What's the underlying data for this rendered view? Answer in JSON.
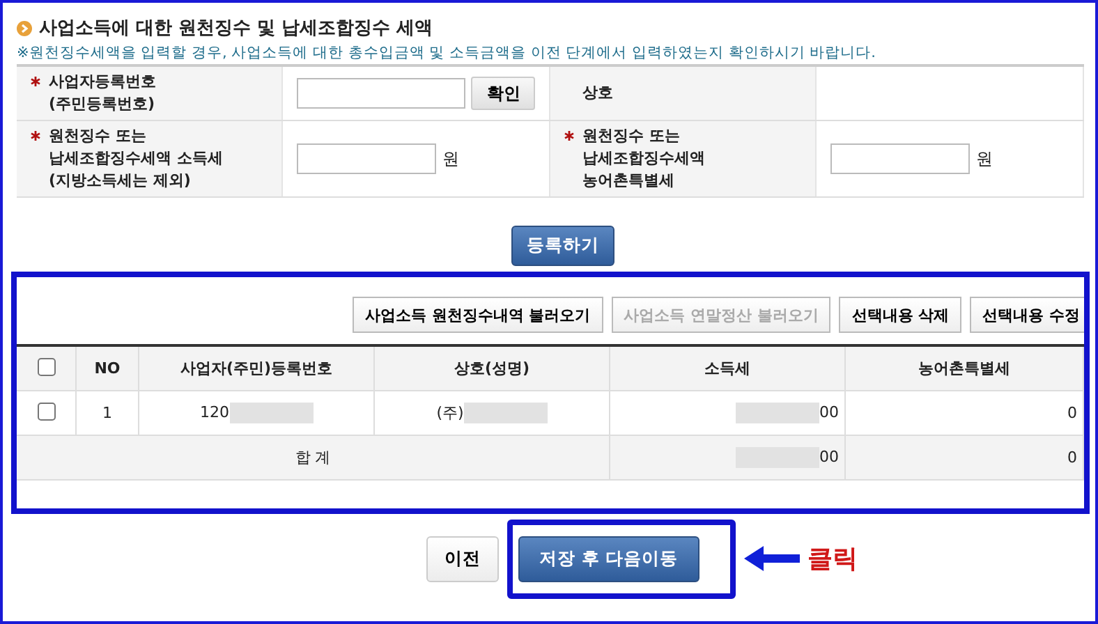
{
  "section": {
    "title": "사업소득에 대한 원천징수 및 납세조합징수 세액",
    "note": "※원천징수세액을 입력할 경우, 사업소득에 대한 총수입금액 및 소득금액을 이전 단계에서 입력하였는지 확인하시기 바랍니다."
  },
  "form": {
    "rows": [
      {
        "cells": [
          {
            "kind": "label",
            "required": true,
            "lines": [
              "사업자등록번호",
              "(주민등록번호)"
            ]
          },
          {
            "kind": "input",
            "button": "확인"
          },
          {
            "kind": "label",
            "required": false,
            "lines": [
              "상호"
            ]
          },
          {
            "kind": "blank"
          }
        ]
      },
      {
        "cells": [
          {
            "kind": "label",
            "required": true,
            "lines": [
              "원천징수 또는",
              "납세조합징수세액 소득세",
              "(지방소득세는 제외)"
            ]
          },
          {
            "kind": "input",
            "unit": "원"
          },
          {
            "kind": "label",
            "required": true,
            "lines": [
              "원천징수 또는",
              "납세조합징수세액",
              "농어촌특별세"
            ]
          },
          {
            "kind": "input",
            "unit": "원"
          }
        ]
      }
    ],
    "register_button": "등록하기"
  },
  "toolbar": [
    {
      "label": "사업소득 원천징수내역 불러오기",
      "disabled": false
    },
    {
      "label": "사업소득 연말정산 불러오기",
      "disabled": true
    },
    {
      "label": "선택내용 삭제",
      "disabled": false
    },
    {
      "label": "선택내용 수정",
      "disabled": false
    }
  ],
  "table": {
    "columns": [
      "NO",
      "사업자(주민)등록번호",
      "상호(성명)",
      "소득세",
      "농어촌특별세"
    ],
    "header_checked": false,
    "rows": [
      {
        "checked": false,
        "cells": [
          "1",
          "120",
          "(주)",
          "00",
          "0"
        ],
        "redacted": [
          false,
          true,
          true,
          true,
          false
        ]
      }
    ],
    "total": {
      "label": "합 계",
      "cells": [
        "00",
        "0"
      ],
      "redacted": [
        true,
        false
      ]
    }
  },
  "footer": {
    "prev_button": "이전",
    "save_button": "저장 후 다음이동",
    "callout": "클릭"
  }
}
